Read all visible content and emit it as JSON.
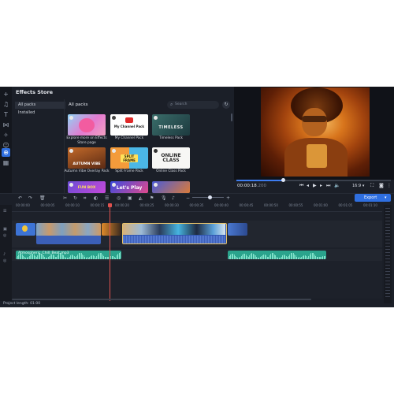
{
  "store": {
    "title": "Effects Store",
    "nav": [
      "All packs",
      "Installed"
    ],
    "section_title": "All packs",
    "search_placeholder": "Search",
    "packs": [
      {
        "label": "Explore more on Effects Store page",
        "thumb_text": ""
      },
      {
        "label": "My Channel Pack",
        "thumb_text": "My Channel Pack"
      },
      {
        "label": "Timeless Pack",
        "thumb_text": "TIMELESS"
      },
      {
        "label": "Autumn Vibe Overlay Pack",
        "thumb_text": "AUTUMN VIBE"
      },
      {
        "label": "Split Frame Pack",
        "thumb_text": "SPLIT FRAME"
      },
      {
        "label": "Online Class Pack",
        "thumb_text": "ONLINE CLASS"
      },
      {
        "label": "",
        "thumb_text": "FUN BOX"
      },
      {
        "label": "",
        "thumb_text": "Let's Play"
      },
      {
        "label": "",
        "thumb_text": ""
      }
    ]
  },
  "player": {
    "time_main": "00:00:18",
    "time_ms": ".200",
    "aspect_ratio": "16:9",
    "progress": 0.3
  },
  "toolbar": {
    "export_label": "Export"
  },
  "timeline": {
    "ruler_labels": [
      "00:00:00",
      "00:00:05",
      "00:00:10",
      "00:00:15",
      "00:00:20",
      "00:00:25",
      "00:00:30",
      "00:00:35",
      "00:00:40",
      "00:00:45",
      "00:00:50",
      "00:00:55",
      "00:01:00",
      "00:01:05",
      "00:01:10"
    ],
    "audio_clip_name": "Atmospheric_Chill_Beat.mp3",
    "status": "Project length: 01:00"
  },
  "colors": {
    "accent": "#2f6fe0",
    "audio_clip": "#2aa38c",
    "playhead": "#e0524f",
    "selection": "#e9c46a"
  }
}
